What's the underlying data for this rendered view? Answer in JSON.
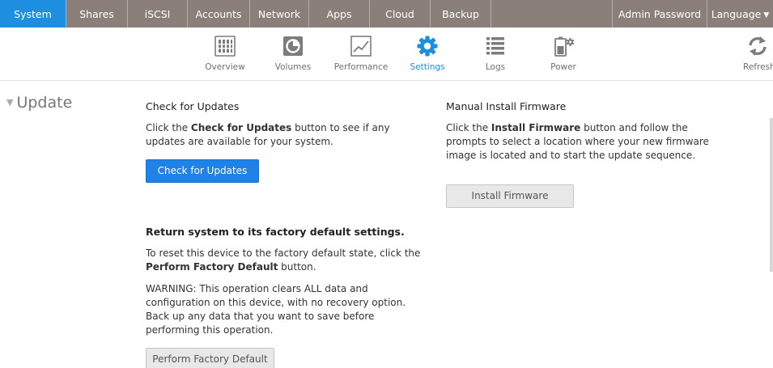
{
  "topnav": {
    "tabs": [
      {
        "label": "System",
        "active": true
      },
      {
        "label": "Shares"
      },
      {
        "label": "iSCSI"
      },
      {
        "label": "Accounts"
      },
      {
        "label": "Network"
      },
      {
        "label": "Apps"
      },
      {
        "label": "Cloud"
      },
      {
        "label": "Backup"
      }
    ],
    "admin_password": "Admin Password",
    "language": "Language",
    "accent_color": "#1e8fe0",
    "bar_color": "#8a8079"
  },
  "subnav": {
    "items": [
      {
        "label": "Overview",
        "icon": "overview-icon"
      },
      {
        "label": "Volumes",
        "icon": "volumes-icon"
      },
      {
        "label": "Performance",
        "icon": "performance-icon"
      },
      {
        "label": "Settings",
        "icon": "settings-icon",
        "active": true
      },
      {
        "label": "Logs",
        "icon": "logs-icon"
      },
      {
        "label": "Power",
        "icon": "power-icon"
      }
    ],
    "refresh": "Refresh"
  },
  "section": {
    "title": "Update"
  },
  "check_updates": {
    "heading": "Check for Updates",
    "desc_pre": "Click the ",
    "desc_bold": "Check for Updates",
    "desc_post": " button to see if any updates are available for your system.",
    "button": "Check for Updates"
  },
  "factory": {
    "heading": "Return system to its factory default settings.",
    "desc_pre": "To reset this device to the factory default state, click the ",
    "desc_bold": "Perform Factory Default",
    "desc_post": " button.",
    "warning": "WARNING: This operation clears ALL data and configuration on this device, with no recovery option. Back up any data that you want to save before performing this operation.",
    "button": "Perform Factory Default"
  },
  "manual_install": {
    "heading": "Manual Install Firmware",
    "desc_pre": "Click the ",
    "desc_bold": "Install Firmware",
    "desc_post": " button and follow the prompts to select a location where your new firmware image is located and to start the update sequence.",
    "button": "Install Firmware"
  }
}
